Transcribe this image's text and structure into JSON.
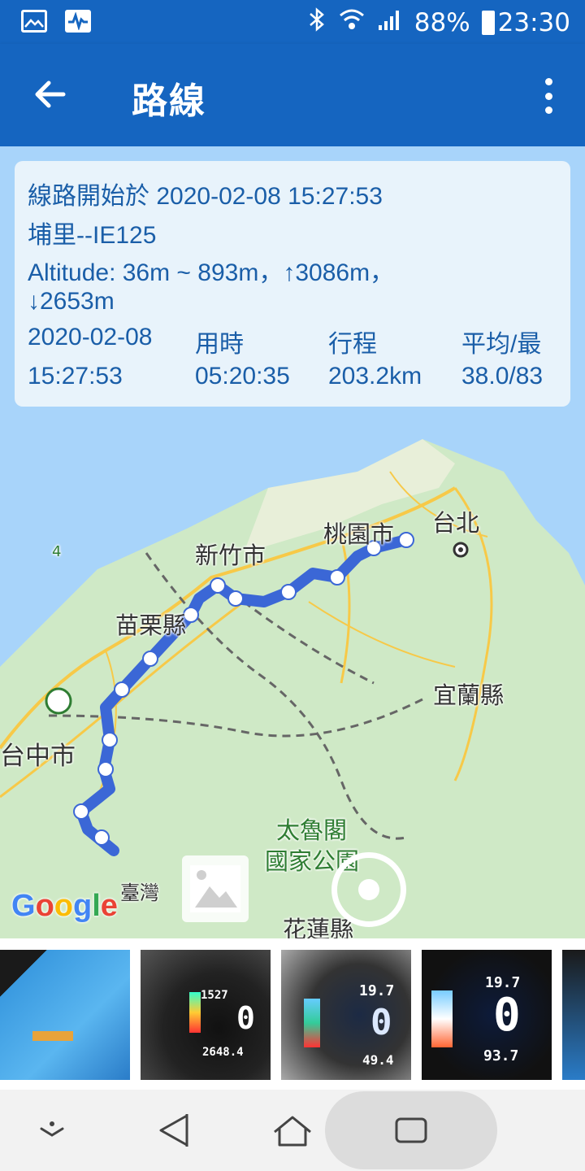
{
  "status_bar": {
    "battery": "88%",
    "time": "23:30",
    "icons": [
      "gallery-icon",
      "activity-icon",
      "bluetooth-icon",
      "wifi-icon",
      "signal-icon",
      "battery-icon"
    ]
  },
  "app_bar": {
    "title": "路線",
    "back_icon": "arrow-left-icon",
    "menu_icon": "more-vert-icon"
  },
  "route_info": {
    "start_line": "線路開始於 2020-02-08 15:27:53",
    "name": "埔里--IE125",
    "altitude_line1": "Altitude: 36m ~ 893m，↑3086m，",
    "altitude_line2": "↓2653m",
    "stats": [
      {
        "label": "2020-02-08",
        "value": "15:27:53"
      },
      {
        "label": "用時",
        "value": "05:20:35"
      },
      {
        "label": "行程",
        "value": "203.2km"
      },
      {
        "label": "平均/最",
        "value": "38.0/83"
      }
    ]
  },
  "map": {
    "labels": {
      "taoyuan": "桃園市",
      "taipei": "台北",
      "hsinchu": "新竹市",
      "miaoli": "苗栗縣",
      "yilan": "宜蘭縣",
      "taichung": "台中市",
      "park1": "太魯閣",
      "park2": "國家公園",
      "taiwan": "臺灣",
      "hualien": "花蓮縣",
      "highway": "4"
    },
    "attribution": "Google",
    "colors": {
      "water": "#a8d4fa",
      "land": "#cfe9c6",
      "route": "#3b67d6"
    }
  },
  "photos": [
    {
      "name": "battery-pack-photo"
    },
    {
      "name": "dashboard-photo-1",
      "top": "1527",
      "bottom": "2648.4"
    },
    {
      "name": "dashboard-photo-2",
      "top": "19.7",
      "bottom": "49.4"
    },
    {
      "name": "dashboard-photo-3",
      "top": "19.7",
      "bottom": "93.7"
    },
    {
      "name": "partial-photo"
    }
  ],
  "nav_bar": {
    "icons": [
      "hide-keyboard-icon",
      "back-triangle-icon",
      "home-icon",
      "recents-icon"
    ]
  }
}
